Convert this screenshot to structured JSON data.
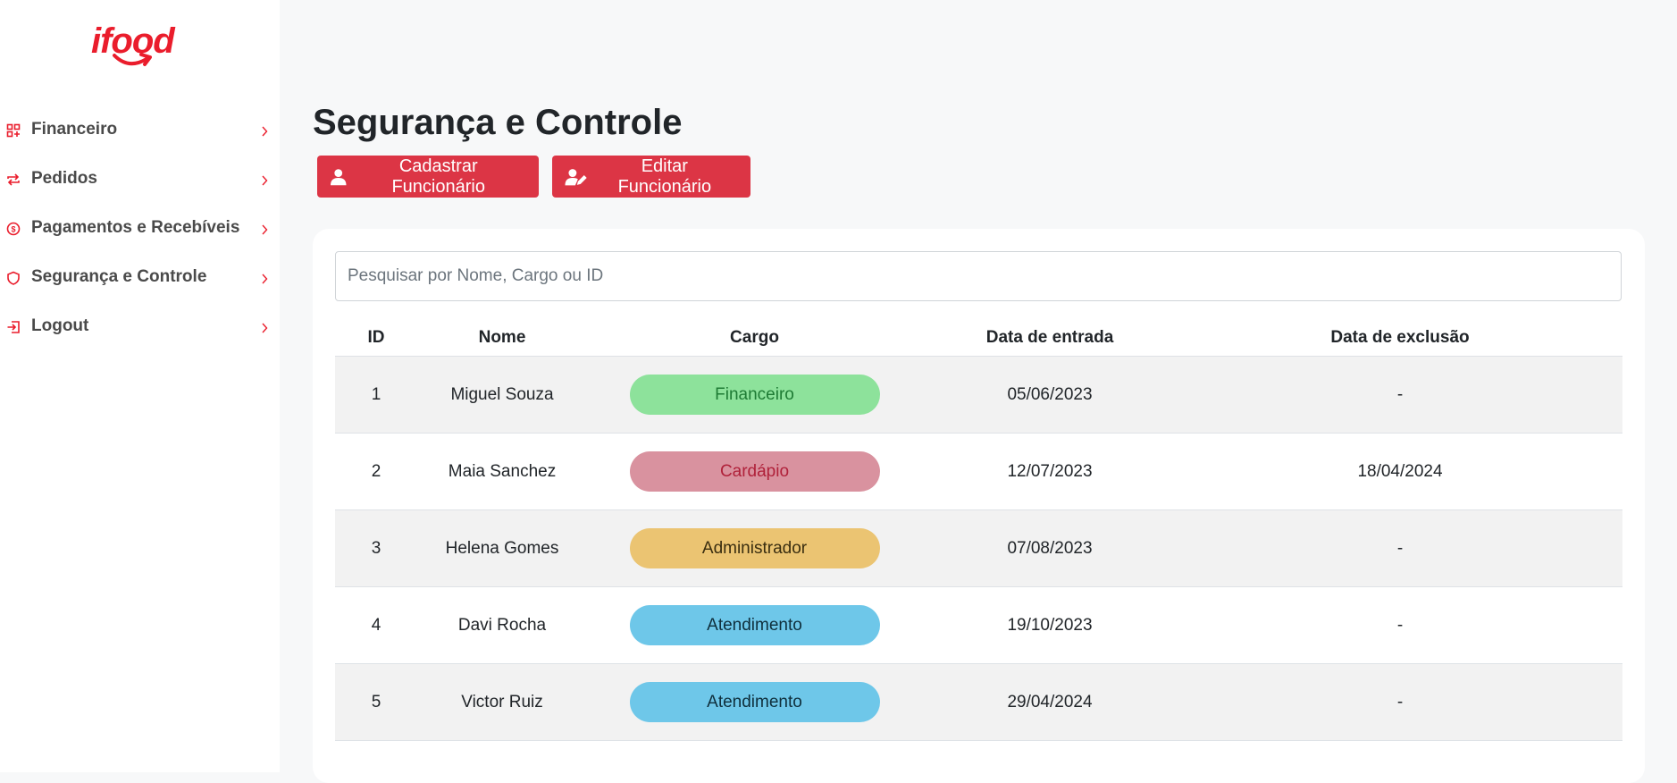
{
  "brand": {
    "logo_text": "ifood",
    "accent": "#ea1d2c"
  },
  "sidebar": {
    "items": [
      {
        "label": "Financeiro",
        "icon": "grid-icon"
      },
      {
        "label": "Pedidos",
        "icon": "repeat-icon"
      },
      {
        "label": "Pagamentos e Recebíveis",
        "icon": "dollar-circle-icon"
      },
      {
        "label": "Segurança e Controle",
        "icon": "shield-icon"
      },
      {
        "label": "Logout",
        "icon": "logout-icon"
      }
    ]
  },
  "main": {
    "title": "Segurança e Controle",
    "add_button": "Cadastrar Funcionário",
    "edit_button": "Editar Funcionário",
    "search_placeholder": "Pesquisar por Nome, Cargo ou ID",
    "search_value": ""
  },
  "table": {
    "headers": [
      "ID",
      "Nome",
      "Cargo",
      "Data de entrada",
      "Data de exclusão"
    ],
    "rows": [
      {
        "id": "1",
        "nome": "Miguel Souza",
        "cargo": "Financeiro",
        "entrada": "05/06/2023",
        "exclusao": "-",
        "pill_bg": "#8de29b",
        "pill_fg": "#1e7b34"
      },
      {
        "id": "2",
        "nome": "Maia Sanchez",
        "cargo": "Cardápio",
        "entrada": "12/07/2023",
        "exclusao": "18/04/2024",
        "pill_bg": "#d9929f",
        "pill_fg": "#b0213a"
      },
      {
        "id": "3",
        "nome": "Helena Gomes",
        "cargo": "Administrador",
        "entrada": "07/08/2023",
        "exclusao": "-",
        "pill_bg": "#ebc472",
        "pill_fg": "#3a2e10"
      },
      {
        "id": "4",
        "nome": "Davi Rocha",
        "cargo": "Atendimento",
        "entrada": "19/10/2023",
        "exclusao": "-",
        "pill_bg": "#6ec7e9",
        "pill_fg": "#0f2f3c"
      },
      {
        "id": "5",
        "nome": "Victor Ruiz",
        "cargo": "Atendimento",
        "entrada": "29/04/2024",
        "exclusao": "-",
        "pill_bg": "#6ec7e9",
        "pill_fg": "#0f2f3c"
      }
    ]
  }
}
